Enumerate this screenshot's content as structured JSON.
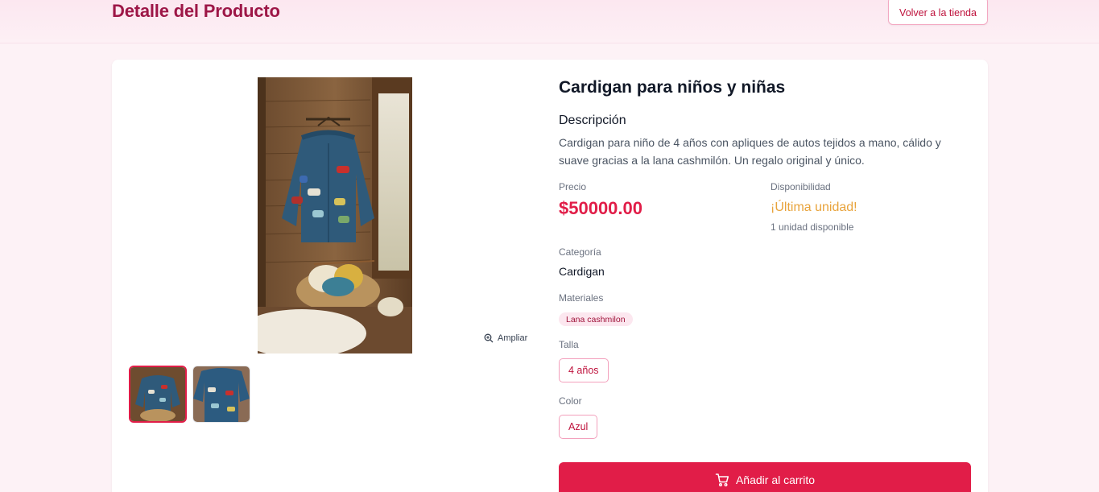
{
  "header": {
    "title": "Detalle del Producto",
    "back_label": "Volver a la tienda"
  },
  "gallery": {
    "zoom_label": "Ampliar",
    "thumbnail_count": 2,
    "active_thumbnail": 1
  },
  "product": {
    "name": "Cardigan para niños y niñas",
    "description_heading": "Descripción",
    "description": "Cardigan para niño de 4 años con apliques de autos tejidos a mano, cálido y suave gracias a la lana cashmilón. Un regalo original y único.",
    "price_label": "Precio",
    "price": "$50000.00",
    "availability_label": "Disponibilidad",
    "availability": "¡Última unidad!",
    "availability_detail": "1 unidad disponible",
    "category_label": "Categoría",
    "category": "Cardigan",
    "materials_label": "Materiales",
    "materials": [
      "Lana cashmilon"
    ],
    "size_label": "Talla",
    "sizes": [
      "4 años"
    ],
    "color_label": "Color",
    "colors": [
      "Azul"
    ],
    "add_to_cart_label": "Añadir al carrito"
  },
  "colors": {
    "brand": "#9d1747",
    "accent": "#e11d48",
    "availability": "#e8a33b"
  }
}
